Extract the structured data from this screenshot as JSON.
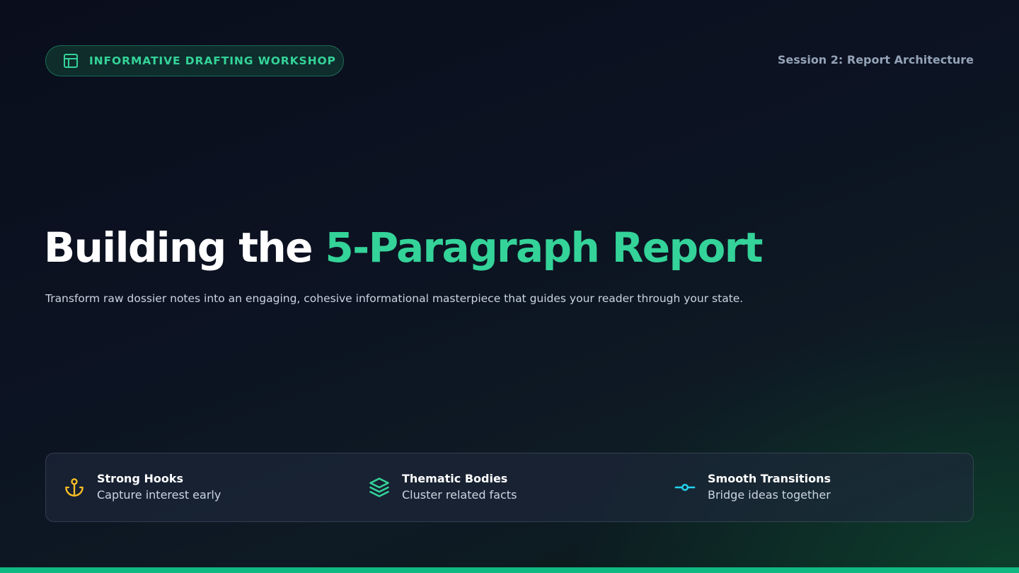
{
  "header": {
    "badge_label": "INFORMATIVE DRAFTING WORKSHOP",
    "badge_icon": "layout-icon",
    "session": "Session 2: Report Architecture"
  },
  "hero": {
    "title_prefix": "Building the ",
    "title_accent": "5-Paragraph Report",
    "subtitle": "Transform raw dossier notes into an engaging, cohesive informational masterpiece that guides your reader through your state."
  },
  "features": [
    {
      "icon": "anchor-icon",
      "title": "Strong Hooks",
      "description": "Capture interest early",
      "color": "#fbbf24"
    },
    {
      "icon": "layers-icon",
      "title": "Thematic Bodies",
      "description": "Cluster related facts",
      "color": "#34d399"
    },
    {
      "icon": "git-commit-icon",
      "title": "Smooth Transitions",
      "description": "Bridge ideas together",
      "color": "#22d3ee"
    }
  ],
  "colors": {
    "accent": "#34d399",
    "accent_bar": "#10b981",
    "muted_text": "#94a3b8",
    "body_text": "#cbd5e1"
  }
}
